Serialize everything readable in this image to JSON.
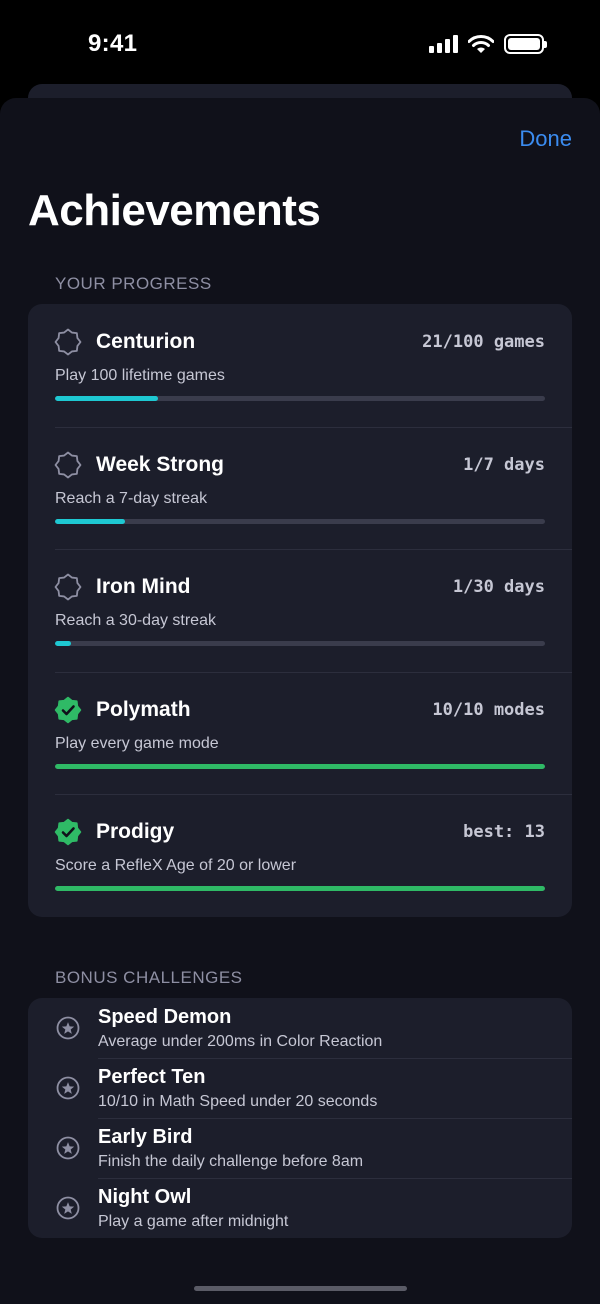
{
  "status_bar": {
    "time": "9:41"
  },
  "header": {
    "done_label": "Done",
    "title": "Achievements"
  },
  "colors": {
    "accent": "#3b8cf0",
    "progress_cyan": "#1ec8d2",
    "complete_green": "#2fba66",
    "card_bg": "#1c1e2b",
    "sheet_bg": "#10111a"
  },
  "progress_section": {
    "label": "YOUR PROGRESS",
    "items": [
      {
        "title": "Centurion",
        "value": "21/100 games",
        "description": "Play 100 lifetime games",
        "progress": 0.21,
        "completed": false,
        "icon": "badge-outline-icon"
      },
      {
        "title": "Week Strong",
        "value": "1/7 days",
        "description": "Reach a 7-day streak",
        "progress": 0.143,
        "completed": false,
        "icon": "badge-outline-icon"
      },
      {
        "title": "Iron Mind",
        "value": "1/30 days",
        "description": "Reach a 30-day streak",
        "progress": 0.033,
        "completed": false,
        "icon": "badge-outline-icon"
      },
      {
        "title": "Polymath",
        "value": "10/10 modes",
        "description": "Play every game mode",
        "progress": 1,
        "completed": true,
        "icon": "badge-check-icon"
      },
      {
        "title": "Prodigy",
        "value": "best: 13",
        "description": "Score a RefleX Age of 20 or lower",
        "progress": 1,
        "completed": true,
        "icon": "badge-check-icon"
      }
    ]
  },
  "bonus_section": {
    "label": "BONUS CHALLENGES",
    "items": [
      {
        "title": "Speed Demon",
        "description": "Average under 200ms in Color Reaction",
        "icon": "star-circle-icon"
      },
      {
        "title": "Perfect Ten",
        "description": "10/10 in Math Speed under 20 seconds",
        "icon": "star-circle-icon"
      },
      {
        "title": "Early Bird",
        "description": "Finish the daily challenge before 8am",
        "icon": "star-circle-icon"
      },
      {
        "title": "Night Owl",
        "description": "Play a game after midnight",
        "icon": "star-circle-icon"
      }
    ]
  }
}
